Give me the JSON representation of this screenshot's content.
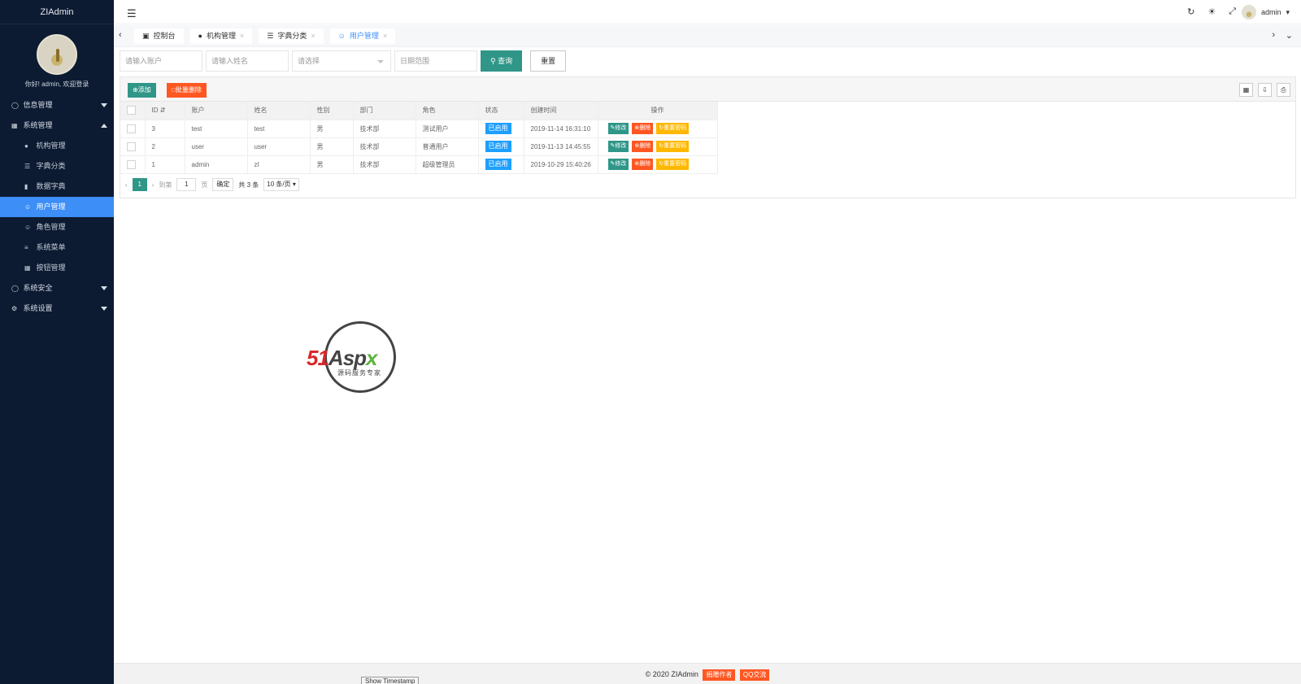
{
  "app": {
    "title": "ZIAdmin"
  },
  "sidebar": {
    "welcome": "你好! admin, 欢迎登录",
    "menu": [
      {
        "label": "信息管理",
        "icon": "user-circle-icon",
        "level": 1,
        "expanded": false
      },
      {
        "label": "系统管理",
        "icon": "grid-icon",
        "level": 1,
        "expanded": true
      },
      {
        "label": "机构管理",
        "icon": "users-icon",
        "level": 2
      },
      {
        "label": "字典分类",
        "icon": "tree-icon",
        "level": 2
      },
      {
        "label": "数据字典",
        "icon": "bar-chart-icon",
        "level": 2
      },
      {
        "label": "用户管理",
        "icon": "user-icon",
        "level": 2,
        "active": true
      },
      {
        "label": "角色管理",
        "icon": "user-role-icon",
        "level": 2
      },
      {
        "label": "系统菜单",
        "icon": "list-icon",
        "level": 2
      },
      {
        "label": "按钮管理",
        "icon": "apps-icon",
        "level": 2
      },
      {
        "label": "系统安全",
        "icon": "shield-icon",
        "level": 1,
        "expanded": false
      },
      {
        "label": "系统设置",
        "icon": "gear-icon",
        "level": 1,
        "expanded": false
      }
    ]
  },
  "header": {
    "username": "admin"
  },
  "tabs": [
    {
      "label": "控制台",
      "icon": "monitor-icon",
      "closable": false
    },
    {
      "label": "机构管理",
      "icon": "users-icon",
      "closable": true
    },
    {
      "label": "字典分类",
      "icon": "tree-icon",
      "closable": true
    },
    {
      "label": "用户管理",
      "icon": "user-icon",
      "closable": true,
      "active": true
    }
  ],
  "search": {
    "account_placeholder": "请输入账户",
    "name_placeholder": "请输入姓名",
    "select_placeholder": "请选择",
    "date_placeholder": "日期范围",
    "query_label": "查询",
    "reset_label": "重置"
  },
  "toolbar": {
    "add_label": "添加",
    "batch_delete_label": "批量删除"
  },
  "table": {
    "columns": [
      "ID",
      "账户",
      "姓名",
      "性别",
      "部门",
      "角色",
      "状态",
      "创建时间",
      "操作"
    ],
    "rows": [
      {
        "id": "3",
        "account": "test",
        "name": "test",
        "gender": "男",
        "dept": "技术部",
        "role": "测试用户",
        "status": "已启用",
        "created": "2019-11-14 16:31:10"
      },
      {
        "id": "2",
        "account": "user",
        "name": "user",
        "gender": "男",
        "dept": "技术部",
        "role": "普通用户",
        "status": "已启用",
        "created": "2019-11-13 14:45:55"
      },
      {
        "id": "1",
        "account": "admin",
        "name": "zl",
        "gender": "男",
        "dept": "技术部",
        "role": "超级管理员",
        "status": "已启用",
        "created": "2019-10-29 15:40:26"
      }
    ],
    "actions": {
      "edit": "修改",
      "delete": "删除",
      "reset_pwd": "重置密码"
    }
  },
  "pager": {
    "current": "1",
    "goto_label": "到第",
    "page_input": "1",
    "page_unit": "页",
    "confirm": "确定",
    "total": "共 3 条",
    "page_size": "10 条/页"
  },
  "watermark": {
    "brand_a": "51",
    "brand_b": "Asp",
    "brand_c": "x",
    "tagline": "源码服务专家"
  },
  "footer": {
    "copyright": "© 2020 ZIAdmin",
    "contact_btn": "捐赠作者",
    "qq_btn": "QQ交流",
    "timestamp_btn": "Show Timestamp"
  },
  "colors": {
    "sidebar_bg": "#0c1b32",
    "active_blue": "#3d8ef6",
    "primary_green": "#2f9688",
    "danger_orange": "#ff5722",
    "warn_yellow": "#ffb800",
    "info_blue": "#1e9fff"
  }
}
